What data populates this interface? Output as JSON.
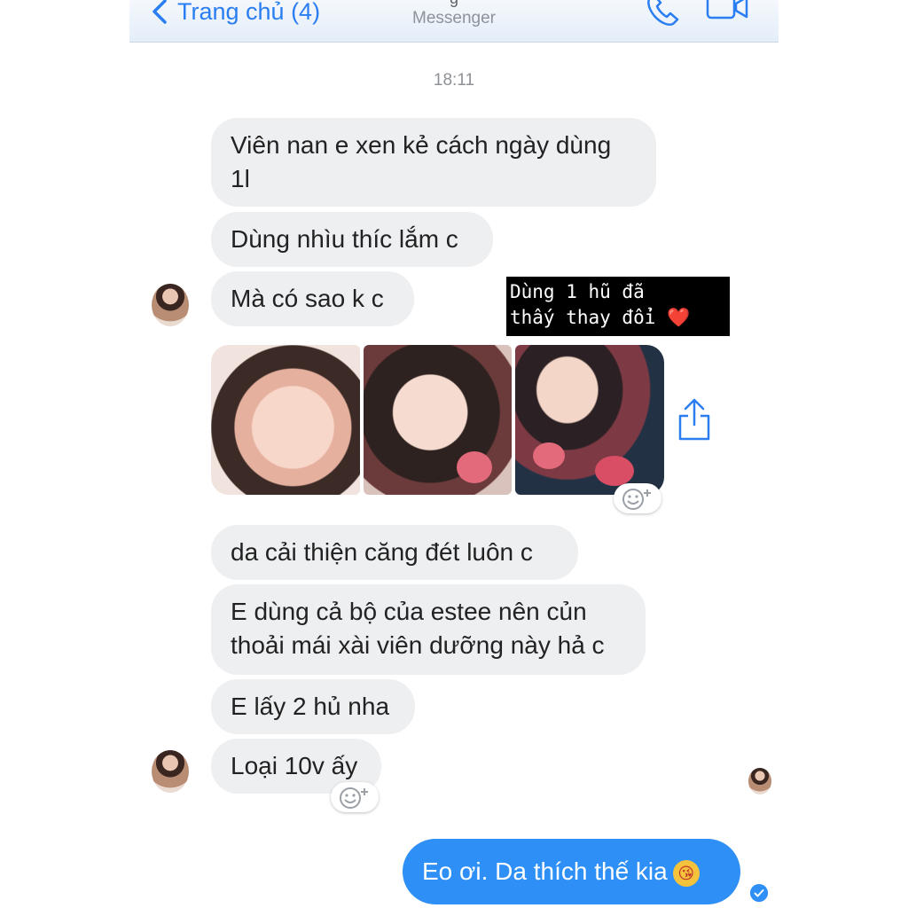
{
  "header": {
    "back_label": "Trang chủ (4)",
    "title_fragment": "g",
    "subtitle": "Messenger"
  },
  "timestamp": "18:11",
  "messages": [
    {
      "text": "Viên nan e xen kẻ cách ngày dùng 1l"
    },
    {
      "text": "Dùng nhìu thíc lắm c"
    },
    {
      "text": "Mà có sao k c"
    },
    {
      "text": "da cải thiện căng đét luôn c"
    },
    {
      "text": "E dùng cả bộ của estee nên củn thoải mái xài viên dưỡng này hả c"
    },
    {
      "text": "E lấy 2 hủ nha"
    },
    {
      "text": "Loại 10v ấy"
    }
  ],
  "sticker": {
    "line1": "Dùng 1 hũ đã",
    "line2": "thấy thay đổi",
    "heart": "❤️"
  },
  "my_message": {
    "text": "Eo ơi. Da thích thế kia",
    "emoji": "😘"
  },
  "icons": {
    "back": "chevron-left-icon",
    "call": "phone-icon",
    "video": "video-camera-icon",
    "share": "share-icon",
    "reaction": "add-reaction-icon",
    "seen": "seen-check-icon"
  },
  "colors": {
    "accent": "#2a7ef2",
    "my_bubble": "#2e8ff6",
    "their_bubble": "#eeeff1"
  }
}
